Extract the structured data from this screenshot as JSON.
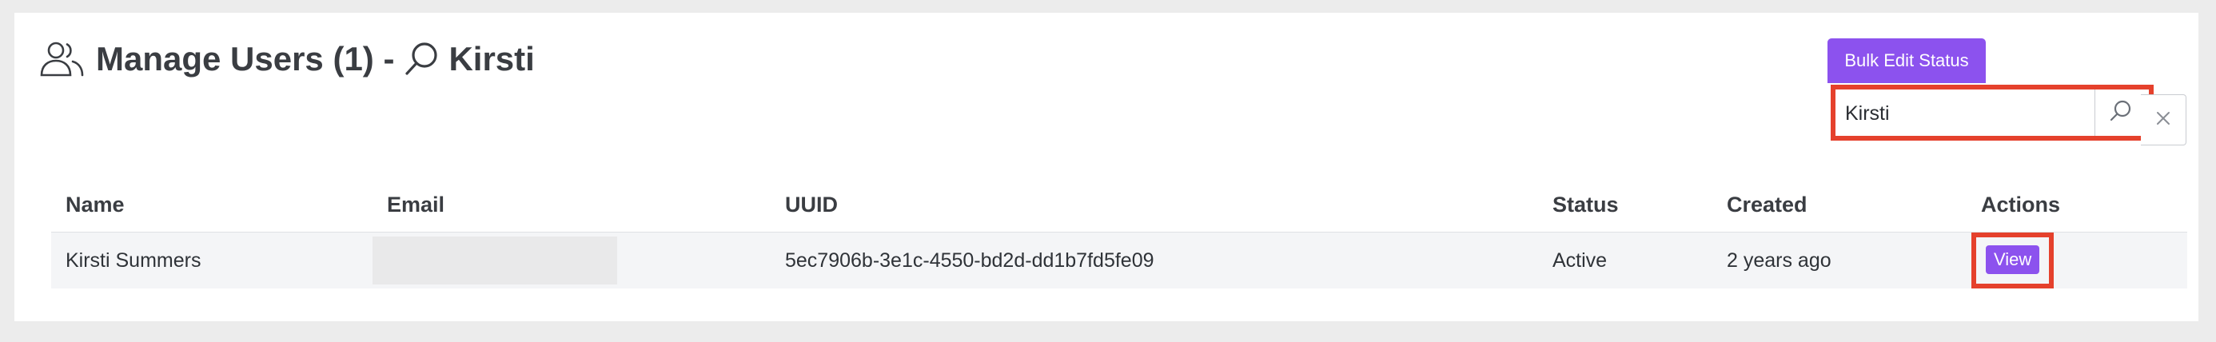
{
  "header": {
    "title_prefix": "Manage Users (1) -",
    "search_term": "Kirsti"
  },
  "toolbar": {
    "bulk_edit_label": "Bulk Edit Status"
  },
  "search": {
    "value": "Kirsti",
    "clear_glyph": "×"
  },
  "table": {
    "headers": [
      "Name",
      "Email",
      "UUID",
      "Status",
      "Created",
      "Actions"
    ],
    "rows": [
      {
        "name": "Kirsti Summers",
        "email": "",
        "uuid": "5ec7906b-3e1c-4550-bd2d-dd1b7fd5fe09",
        "status": "Active",
        "created": "2 years ago",
        "action_label": "View"
      }
    ]
  },
  "colors": {
    "accent": "#8c52ee",
    "highlight": "#e5412c"
  }
}
